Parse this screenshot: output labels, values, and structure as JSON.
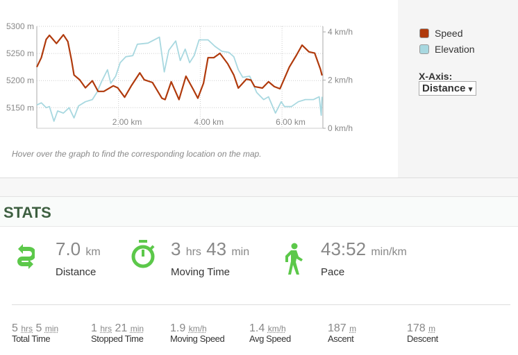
{
  "chart_data": {
    "type": "line",
    "xlabel": "",
    "ylabel_left": "",
    "ylabel_right": "",
    "x_unit": "km",
    "xlim": [
      0,
      7.0
    ],
    "x_ticks": [
      {
        "value": 2,
        "label": "2.00 km"
      },
      {
        "value": 4,
        "label": "4.00 km"
      },
      {
        "value": 6,
        "label": "6.00 km"
      }
    ],
    "y_left": {
      "ticks": [
        {
          "value": 5300,
          "label": "5300 m"
        },
        {
          "value": 5250,
          "label": "5250 m"
        },
        {
          "value": 5200,
          "label": "5200 m"
        },
        {
          "value": 5150,
          "label": "5150 m"
        }
      ],
      "range": [
        5112,
        5300
      ]
    },
    "y_right": {
      "ticks": [
        {
          "value": 4,
          "label": "4 km/h"
        },
        {
          "value": 2,
          "label": "2 km/h"
        },
        {
          "value": 0,
          "label": "0 km/h"
        }
      ],
      "range": [
        0,
        4.23
      ]
    },
    "grid": true,
    "legend_placement": "right",
    "series": [
      {
        "name": "Speed",
        "axis": "right",
        "color": "#b03a0c",
        "x": [
          0,
          0.11,
          0.23,
          0.31,
          0.48,
          0.65,
          0.76,
          0.85,
          0.91,
          1.05,
          1.19,
          1.36,
          1.5,
          1.64,
          1.87,
          1.98,
          2.15,
          2.32,
          2.52,
          2.63,
          2.83,
          3.06,
          3.14,
          3.29,
          3.48,
          3.65,
          3.82,
          3.94,
          4.08,
          4.19,
          4.33,
          4.48,
          4.67,
          4.82,
          4.93,
          5.13,
          5.24,
          5.33,
          5.52,
          5.67,
          5.81,
          5.95,
          6.18,
          6.35,
          6.49,
          6.66,
          6.8,
          6.94,
          6.98
        ],
        "y": [
          2.54,
          2.93,
          3.69,
          3.86,
          3.52,
          3.88,
          3.6,
          2.83,
          2.21,
          2.01,
          1.68,
          1.97,
          1.53,
          1.53,
          1.76,
          1.68,
          1.29,
          1.78,
          2.3,
          2.01,
          1.9,
          1.25,
          1.19,
          1.93,
          1.19,
          2.16,
          1.64,
          1.25,
          1.87,
          2.93,
          2.93,
          3.11,
          2.68,
          2.21,
          1.67,
          2.04,
          2.0,
          1.73,
          1.67,
          1.93,
          1.73,
          1.64,
          2.54,
          3.02,
          3.45,
          3.17,
          3.12,
          2.45,
          2.19
        ]
      },
      {
        "name": "Elevation",
        "axis": "left",
        "color": "#a8d8e0",
        "x": [
          0,
          0.11,
          0.23,
          0.31,
          0.42,
          0.51,
          0.65,
          0.79,
          0.91,
          1.02,
          1.19,
          1.36,
          1.47,
          1.59,
          1.73,
          1.81,
          1.93,
          2.04,
          2.18,
          2.35,
          2.46,
          2.72,
          3.0,
          3.12,
          3.23,
          3.4,
          3.51,
          3.63,
          3.74,
          3.85,
          3.97,
          4.19,
          4.36,
          4.53,
          4.7,
          4.82,
          4.93,
          5.04,
          5.21,
          5.38,
          5.55,
          5.67,
          5.84,
          5.98,
          6.06,
          6.23,
          6.4,
          6.57,
          6.77,
          6.91,
          6.96,
          6.98
        ],
        "y": [
          5155,
          5159,
          5150,
          5152,
          5125,
          5144,
          5140,
          5150,
          5131,
          5153,
          5161,
          5165,
          5178,
          5199,
          5220,
          5195,
          5208,
          5233,
          5244,
          5246,
          5267,
          5269,
          5280,
          5216,
          5256,
          5273,
          5237,
          5258,
          5233,
          5246,
          5275,
          5275,
          5263,
          5254,
          5252,
          5244,
          5220,
          5206,
          5208,
          5178,
          5165,
          5170,
          5140,
          5161,
          5152,
          5152,
          5161,
          5165,
          5165,
          5170,
          5136,
          5170
        ]
      }
    ]
  },
  "hint": "Hover over the graph to find the corresponding location on the map.",
  "legend": [
    {
      "label": "Speed",
      "color": "#b03a0c"
    },
    {
      "label": "Elevation",
      "color": "#a8d8e0"
    }
  ],
  "xaxis_selector": {
    "label": "X-Axis:",
    "selected": "Distance",
    "arrow": "▾"
  },
  "stats": {
    "heading": "STATS",
    "accent": "#5cc84a",
    "main": [
      {
        "icon": "swap-arrows-icon",
        "value": "7.0",
        "unit": "km",
        "label": "Distance"
      },
      {
        "icon": "stopwatch-icon",
        "value1": "3",
        "unit1": "hrs",
        "value2": "43",
        "unit2": "min",
        "label": "Moving Time"
      },
      {
        "icon": "walking-person-icon",
        "value": "43:52",
        "unit": "min/km",
        "label": "Pace"
      }
    ],
    "secondary": [
      {
        "v1": "5",
        "u1": "hrs",
        "v2": "5",
        "u2": "min",
        "label": "Total Time"
      },
      {
        "v1": "1",
        "u1": "hrs",
        "v2": "21",
        "u2": "min",
        "label": "Stopped Time"
      },
      {
        "v1": "1.9",
        "u1": "km/h",
        "label": "Moving Speed"
      },
      {
        "v1": "1.4",
        "u1": "km/h",
        "label": "Avg Speed"
      },
      {
        "v1": "187",
        "u1": "m",
        "label": "Ascent"
      },
      {
        "v1": "178",
        "u1": "m",
        "label": "Descent"
      }
    ]
  }
}
